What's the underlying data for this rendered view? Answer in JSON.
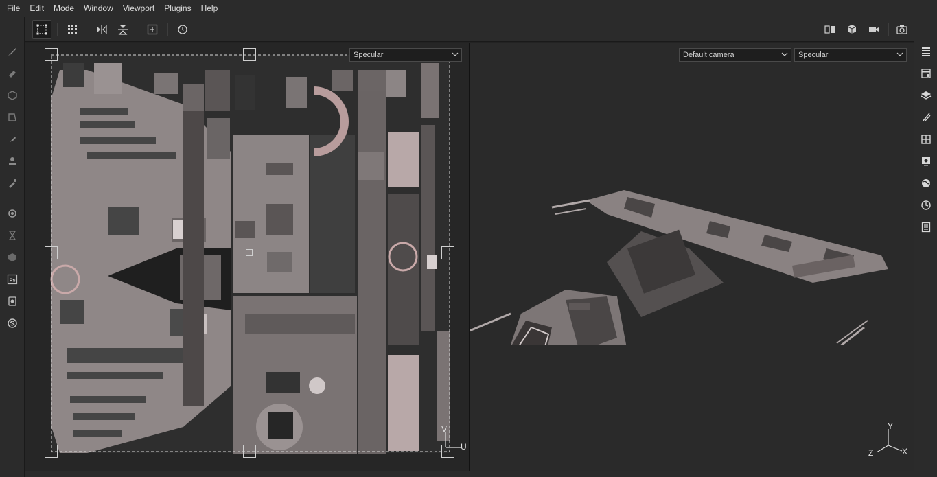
{
  "menu": [
    "File",
    "Edit",
    "Mode",
    "Window",
    "Viewport",
    "Plugins",
    "Help"
  ],
  "left_tools": [
    "brush-icon",
    "eraser-icon",
    "projection-icon",
    "geometry-fill-icon",
    "smudge-icon",
    "clone-stamp-icon",
    "color-picker-icon",
    "bake-icon",
    "hourglass-icon",
    "material-icon",
    "photoshop-icon",
    "iray-icon",
    "substance-icon"
  ],
  "left_tools_ps_label": "Ps",
  "toolbar": {
    "left": [
      "uv-select-icon",
      "grid-tiling-icon",
      "symmetry-x-icon",
      "symmetry-y-icon",
      "fit-view-icon",
      "reset-icon"
    ],
    "right": [
      "split-view-icon",
      "cube-icon",
      "camera-icon",
      "screenshot-icon"
    ]
  },
  "right_tools": [
    "layers-list-icon",
    "texture-set-settings-icon",
    "layers-icon",
    "brush-properties-icon",
    "display-settings-icon",
    "viewer-settings-icon",
    "environment-icon",
    "history-icon",
    "log-icon"
  ],
  "uv_view": {
    "channel_dropdown": "Specular",
    "axis_v": "V",
    "axis_u": "U"
  },
  "view3d": {
    "camera_dropdown": "Default camera",
    "channel_dropdown": "Specular",
    "axis_y": "Y",
    "axis_z": "Z",
    "axis_x": "X"
  },
  "colors": {
    "panel": "#2b2b2b",
    "viewport": "#262626",
    "texture_light": "#928686",
    "texture_dark": "#3a3a3a",
    "accent_pink": "#c9a9a9"
  }
}
